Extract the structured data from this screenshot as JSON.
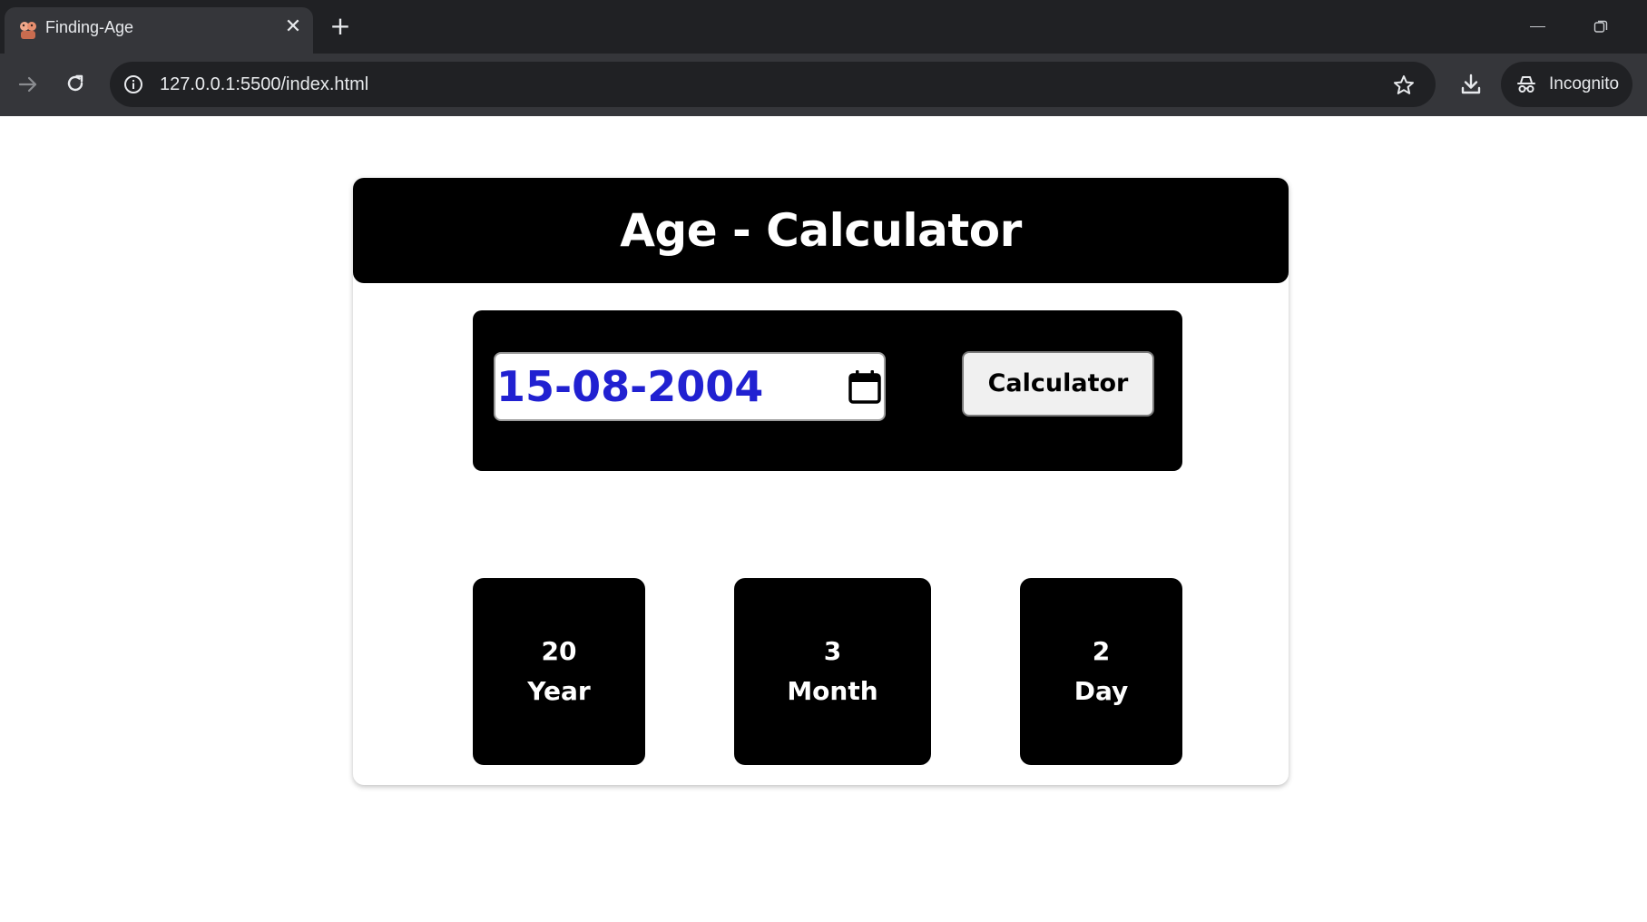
{
  "browser": {
    "tab_title": "Finding-Age",
    "url": "127.0.0.1:5500/index.html",
    "profile_label": "Incognito",
    "colors": {
      "frame": "#202124",
      "toolbar": "#35363a",
      "text": "#e8eaed"
    }
  },
  "app": {
    "title": "Age - Calculator",
    "date_input_value": "15-08-2004",
    "calculate_button_label": "Calculator",
    "results": {
      "years": "20",
      "years_label": "Year",
      "months": "3",
      "months_label": "Month",
      "days": "2",
      "days_label": "Day"
    },
    "colors": {
      "panel": "#000000",
      "date_text": "#2121d1",
      "button_bg": "#f0f0f0"
    }
  }
}
